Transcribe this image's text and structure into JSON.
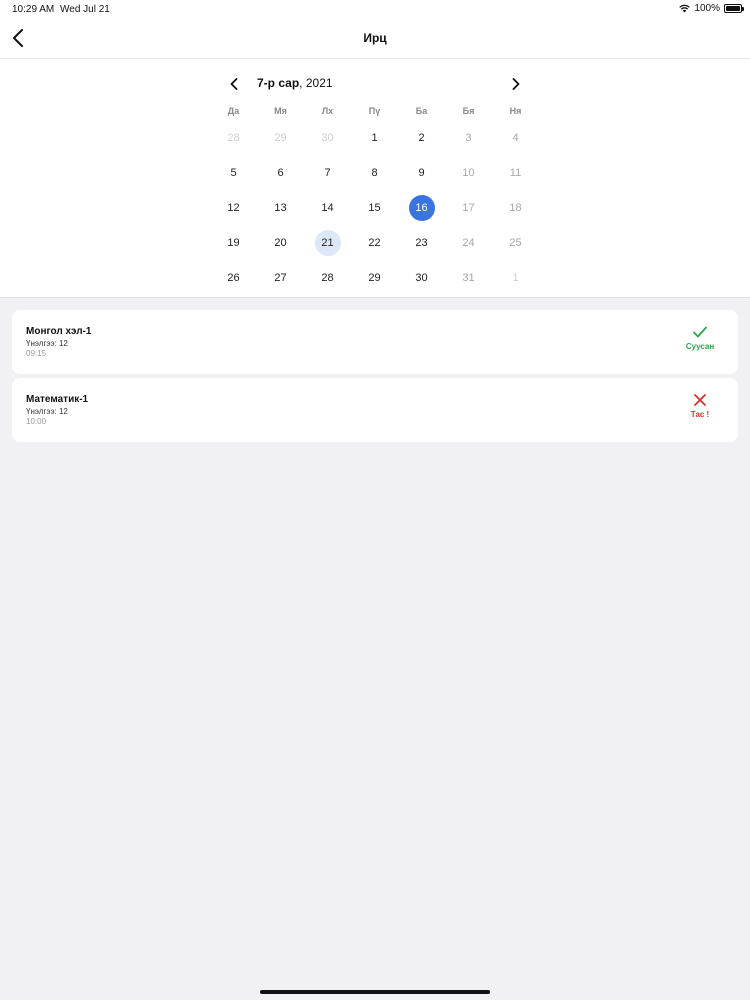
{
  "status_bar": {
    "time": "10:29 AM",
    "date": "Wed Jul 21",
    "battery": "100%"
  },
  "nav": {
    "title": "Ирц",
    "back_icon": "chevron-left-icon"
  },
  "calendar": {
    "month": "7-р сар",
    "year": ", 2021",
    "weekdays": [
      "Да",
      "Мя",
      "Лх",
      "Пү",
      "Ба",
      "Бя",
      "Ня"
    ],
    "days": [
      {
        "d": "28",
        "s": "outside"
      },
      {
        "d": "29",
        "s": "outside"
      },
      {
        "d": "30",
        "s": "outside"
      },
      {
        "d": "1",
        "s": ""
      },
      {
        "d": "2",
        "s": ""
      },
      {
        "d": "3",
        "s": "weekend"
      },
      {
        "d": "4",
        "s": "weekend"
      },
      {
        "d": "5",
        "s": ""
      },
      {
        "d": "6",
        "s": ""
      },
      {
        "d": "7",
        "s": ""
      },
      {
        "d": "8",
        "s": ""
      },
      {
        "d": "9",
        "s": ""
      },
      {
        "d": "10",
        "s": "weekend"
      },
      {
        "d": "11",
        "s": "weekend"
      },
      {
        "d": "12",
        "s": ""
      },
      {
        "d": "13",
        "s": ""
      },
      {
        "d": "14",
        "s": ""
      },
      {
        "d": "15",
        "s": ""
      },
      {
        "d": "16",
        "s": "selected"
      },
      {
        "d": "17",
        "s": "weekend"
      },
      {
        "d": "18",
        "s": "weekend"
      },
      {
        "d": "19",
        "s": ""
      },
      {
        "d": "20",
        "s": ""
      },
      {
        "d": "21",
        "s": "today"
      },
      {
        "d": "22",
        "s": ""
      },
      {
        "d": "23",
        "s": ""
      },
      {
        "d": "24",
        "s": "weekend"
      },
      {
        "d": "25",
        "s": "weekend"
      },
      {
        "d": "26",
        "s": ""
      },
      {
        "d": "27",
        "s": ""
      },
      {
        "d": "28",
        "s": ""
      },
      {
        "d": "29",
        "s": ""
      },
      {
        "d": "30",
        "s": ""
      },
      {
        "d": "31",
        "s": "weekend"
      },
      {
        "d": "1",
        "s": "outside"
      }
    ]
  },
  "colors": {
    "selected": "#3a74e0",
    "today": "#dce8f7",
    "present": "#2aa84a",
    "absent": "#e0302c"
  },
  "lessons": [
    {
      "title": "Монгол хэл-1",
      "sub": "Үнэлгээ: 12",
      "time": "09:15",
      "status": "Суусан",
      "status_type": "present",
      "icon": "checkmark-icon"
    },
    {
      "title": "Математик-1",
      "sub": "Үнэлгээ: 12",
      "time": "10:00",
      "status": "Тас !",
      "status_type": "absent",
      "icon": "cross-icon"
    }
  ]
}
